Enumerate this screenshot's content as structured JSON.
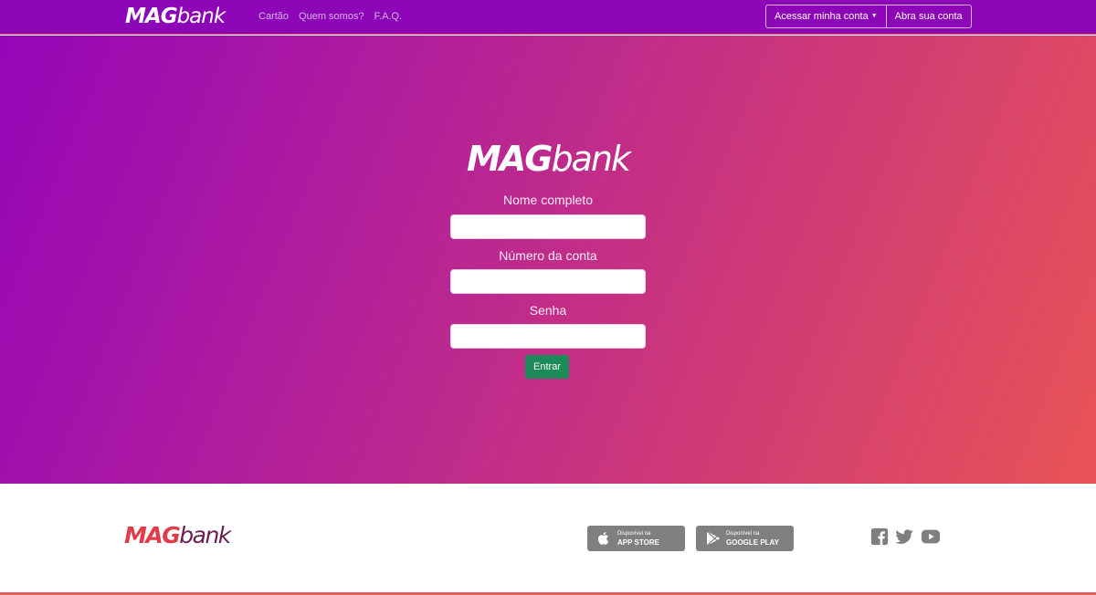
{
  "navbar": {
    "brand_strong": "MAG",
    "brand_light": "bank",
    "links": [
      "Cartão",
      "Quem somos?",
      "F.A.Q."
    ],
    "access_account_label": "Acessar minha conta",
    "open_account_label": "Abra sua conta"
  },
  "hero": {
    "brand_strong": "MAG",
    "brand_light": "bank",
    "form": {
      "full_name_label": "Nome completo",
      "full_name_value": "",
      "account_number_label": "Número da conta",
      "account_number_value": "",
      "password_label": "Senha",
      "password_value": "",
      "submit_label": "Entrar"
    }
  },
  "footer": {
    "brand_strong": "MAG",
    "brand_light": "bank",
    "app_store": {
      "small": "Disponível na",
      "big": "APP STORE"
    },
    "google_play": {
      "small": "Disponível na",
      "big": "GOOGLE PLAY"
    },
    "social_icons": [
      "facebook-icon",
      "twitter-icon",
      "youtube-icon"
    ]
  },
  "colors": {
    "navbar_bg": "#8c06b8",
    "gradient_start": "#9506b8",
    "gradient_end": "#e85455",
    "submit_bg": "#1d8a5a",
    "footer_logo_red": "#e23b4a",
    "footer_logo_purple": "#6b1d4f",
    "badge_gray": "#7f7f7f"
  }
}
